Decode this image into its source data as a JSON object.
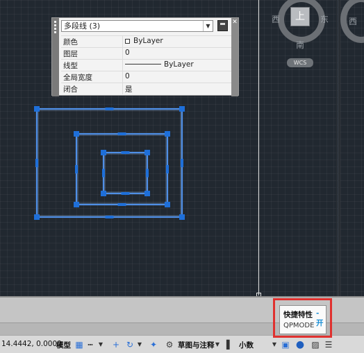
{
  "quick_properties": {
    "object_type": "多段线 (3)",
    "rows": [
      {
        "label": "颜色",
        "value": "ByLayer"
      },
      {
        "label": "图层",
        "value": "0"
      },
      {
        "label": "线型",
        "value": "ByLayer"
      },
      {
        "label": "全局宽度",
        "value": "0"
      },
      {
        "label": "闭合",
        "value": "是"
      }
    ]
  },
  "viewcube": {
    "top_face": "上",
    "west": "西",
    "east": "东",
    "south": "南",
    "west_right": "西",
    "wcs": "WCS"
  },
  "tooltip": {
    "title": "快捷特性",
    "state": "- 开",
    "command": "QPMODE"
  },
  "status_bar": {
    "coordinates": "14.4442, 0.0000",
    "model": "模型",
    "workspace": "草图与注释",
    "units": "小数"
  },
  "colors": {
    "polyline": "#4f8fe6",
    "grip": "#1e6fd9",
    "highlight": "#e0312f",
    "background": "#212830"
  }
}
